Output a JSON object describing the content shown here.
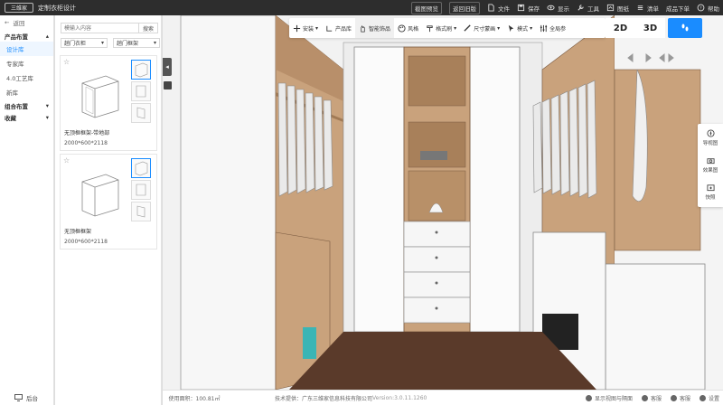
{
  "topbar": {
    "logo": "三维家",
    "title": "定制衣柜设计",
    "actions": [
      {
        "label": "截图预览",
        "icon": "none"
      },
      {
        "label": "返回旧版",
        "icon": "none"
      },
      {
        "label": "文件",
        "icon": "file-icon"
      },
      {
        "label": "保存",
        "icon": "save-icon"
      },
      {
        "label": "显示",
        "icon": "eye-icon"
      },
      {
        "label": "工具",
        "icon": "tool-icon"
      },
      {
        "label": "图纸",
        "icon": "drawing-icon"
      },
      {
        "label": "清单",
        "icon": "list-icon"
      },
      {
        "label": "成品下单",
        "icon": "none"
      },
      {
        "label": "帮助",
        "icon": "help-icon"
      }
    ]
  },
  "sidebar": {
    "back": "返回",
    "sections": [
      {
        "label": "产品布置",
        "items": [
          "设计库",
          "专家库",
          "4.0工艺库",
          "新库"
        ]
      },
      {
        "label": "组合布置",
        "items": []
      },
      {
        "label": "收藏",
        "items": []
      }
    ],
    "active_item": "设计库",
    "bottom": "后台"
  },
  "panel": {
    "search_placeholder": "模输入内容",
    "search_button": "搜索",
    "filter1": "趟门衣柜",
    "filter2": "趟门框架",
    "cards": [
      {
        "name": "无顶框框架-带地部",
        "dims": "2000*600*2118"
      },
      {
        "name": "无顶框框架",
        "dims": "2000*600*2118"
      }
    ]
  },
  "toolbar": {
    "items": [
      {
        "label": "安装",
        "icon": "plus-icon"
      },
      {
        "label": "产品库",
        "icon": "hanger-icon"
      },
      {
        "label": "智能饰品",
        "icon": "hand-icon"
      },
      {
        "label": "风格",
        "icon": "palette-icon"
      },
      {
        "label": "格式刷",
        "icon": "brush-icon"
      },
      {
        "label": "尺寸蒙画",
        "icon": "ruler-icon"
      },
      {
        "label": "模式",
        "icon": "cursor-icon"
      },
      {
        "label": "全局参",
        "icon": "sliders-icon"
      }
    ],
    "view_2d": "2D",
    "view_3d": "3D"
  },
  "right_tools": [
    {
      "label": "导视图",
      "icon": "compass-icon"
    },
    {
      "label": "效果图",
      "icon": "camera-icon"
    },
    {
      "label": "快照",
      "icon": "snapshot-icon"
    }
  ],
  "statusbar": {
    "area": "使用面积：100.81㎡",
    "tech": "技术提供：广东三维家信息科技有限公司",
    "version": "Version:3.0.11.1260",
    "right": [
      "显示视图与隔面",
      "客服",
      "客服",
      "设置"
    ]
  },
  "colors": {
    "accent": "#1a8cff",
    "wood": "#c9a27c",
    "floor": "#5a3a2a"
  }
}
